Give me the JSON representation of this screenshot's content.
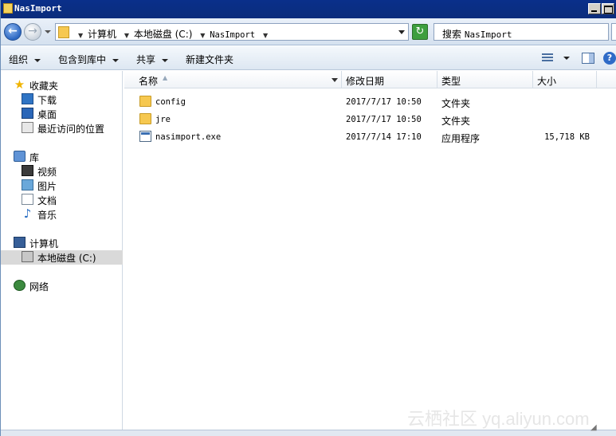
{
  "window": {
    "title": "NasImport"
  },
  "address": {
    "crumbs": [
      "计算机",
      "本地磁盘 (C:)",
      "NasImport"
    ]
  },
  "search": {
    "label": "搜索",
    "scope": "NasImport"
  },
  "toolbar": {
    "organize": "组织",
    "include_in_library": "包含到库中",
    "share": "共享",
    "new_folder": "新建文件夹"
  },
  "nav": {
    "favorites": "收藏夹",
    "downloads": "下载",
    "desktop": "桌面",
    "recent": "最近访问的位置",
    "libraries": "库",
    "videos": "视频",
    "pictures": "图片",
    "documents": "文档",
    "music": "音乐",
    "computer": "计算机",
    "local_disk": "本地磁盘 (C:)",
    "network": "网络"
  },
  "columns": {
    "name": "名称",
    "modified": "修改日期",
    "type": "类型",
    "size": "大小"
  },
  "files": [
    {
      "name": "config",
      "modified": "2017/7/17 10:50",
      "type": "文件夹",
      "size": "",
      "icon": "folder-icon"
    },
    {
      "name": "jre",
      "modified": "2017/7/17 10:50",
      "type": "文件夹",
      "size": "",
      "icon": "folder-icon"
    },
    {
      "name": "nasimport.exe",
      "modified": "2017/7/14 17:10",
      "type": "应用程序",
      "size": "15,718 KB",
      "icon": "exe-icon"
    }
  ],
  "watermark": "云栖社区 yq.aliyun.com",
  "colors": {
    "titlebar": "#0b2d7c",
    "folder": "#f6c850",
    "selection": "#d9d9d9"
  }
}
